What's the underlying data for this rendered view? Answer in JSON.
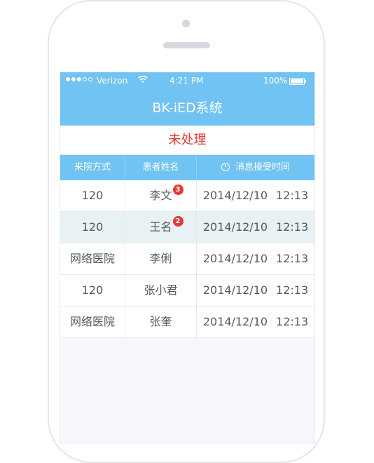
{
  "status_bar": {
    "carrier": "Verizon",
    "time": "4:21 PM",
    "battery": "100%"
  },
  "app": {
    "title": "BK-iED系统",
    "section_title": "未处理"
  },
  "table": {
    "headers": [
      "来院方式",
      "患者姓名",
      "消息接受时间"
    ],
    "rows": [
      {
        "source": "120",
        "name": "李文",
        "badge": "3",
        "date": "2014/12/10",
        "time": "12:13"
      },
      {
        "source": "120",
        "name": "王名",
        "badge": "2",
        "date": "2014/12/10",
        "time": "12:13"
      },
      {
        "source": "网络医院",
        "name": "李俐",
        "badge": "",
        "date": "2014/12/10",
        "time": "12:13"
      },
      {
        "source": "120",
        "name": "张小君",
        "badge": "",
        "date": "2014/12/10",
        "time": "12:13"
      },
      {
        "source": "网络医院",
        "name": "张奎",
        "badge": "",
        "date": "2014/12/10",
        "time": "12:13"
      }
    ]
  },
  "colors": {
    "accent": "#70c3f3",
    "alert": "#e53935"
  }
}
